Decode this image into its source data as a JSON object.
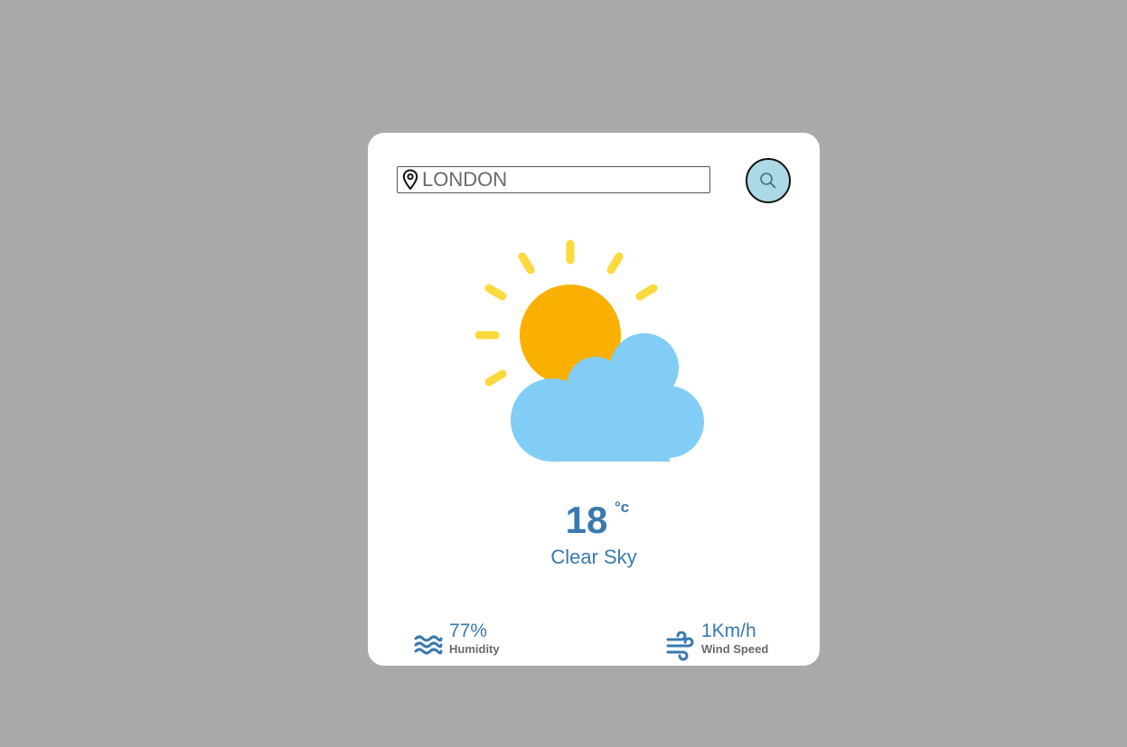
{
  "search": {
    "value": "London",
    "icon": "search-icon",
    "location_icon": "location-pin-icon"
  },
  "weather": {
    "icon": "partly-cloudy-icon",
    "temperature": "18",
    "unit": "°c",
    "condition": "Clear Sky"
  },
  "stats": {
    "humidity": {
      "value": "77%",
      "label": "Humidity",
      "icon": "waves-icon"
    },
    "wind": {
      "value": "1Km/h",
      "label": "Wind Speed",
      "icon": "wind-icon"
    }
  },
  "colors": {
    "background": "#a9a9a9",
    "card": "#ffffff",
    "accent": "#3a79b0",
    "button": "#add8e6",
    "sun": "#f9b000",
    "sun_rays": "#fcd93c",
    "cloud": "#82cdf5"
  }
}
